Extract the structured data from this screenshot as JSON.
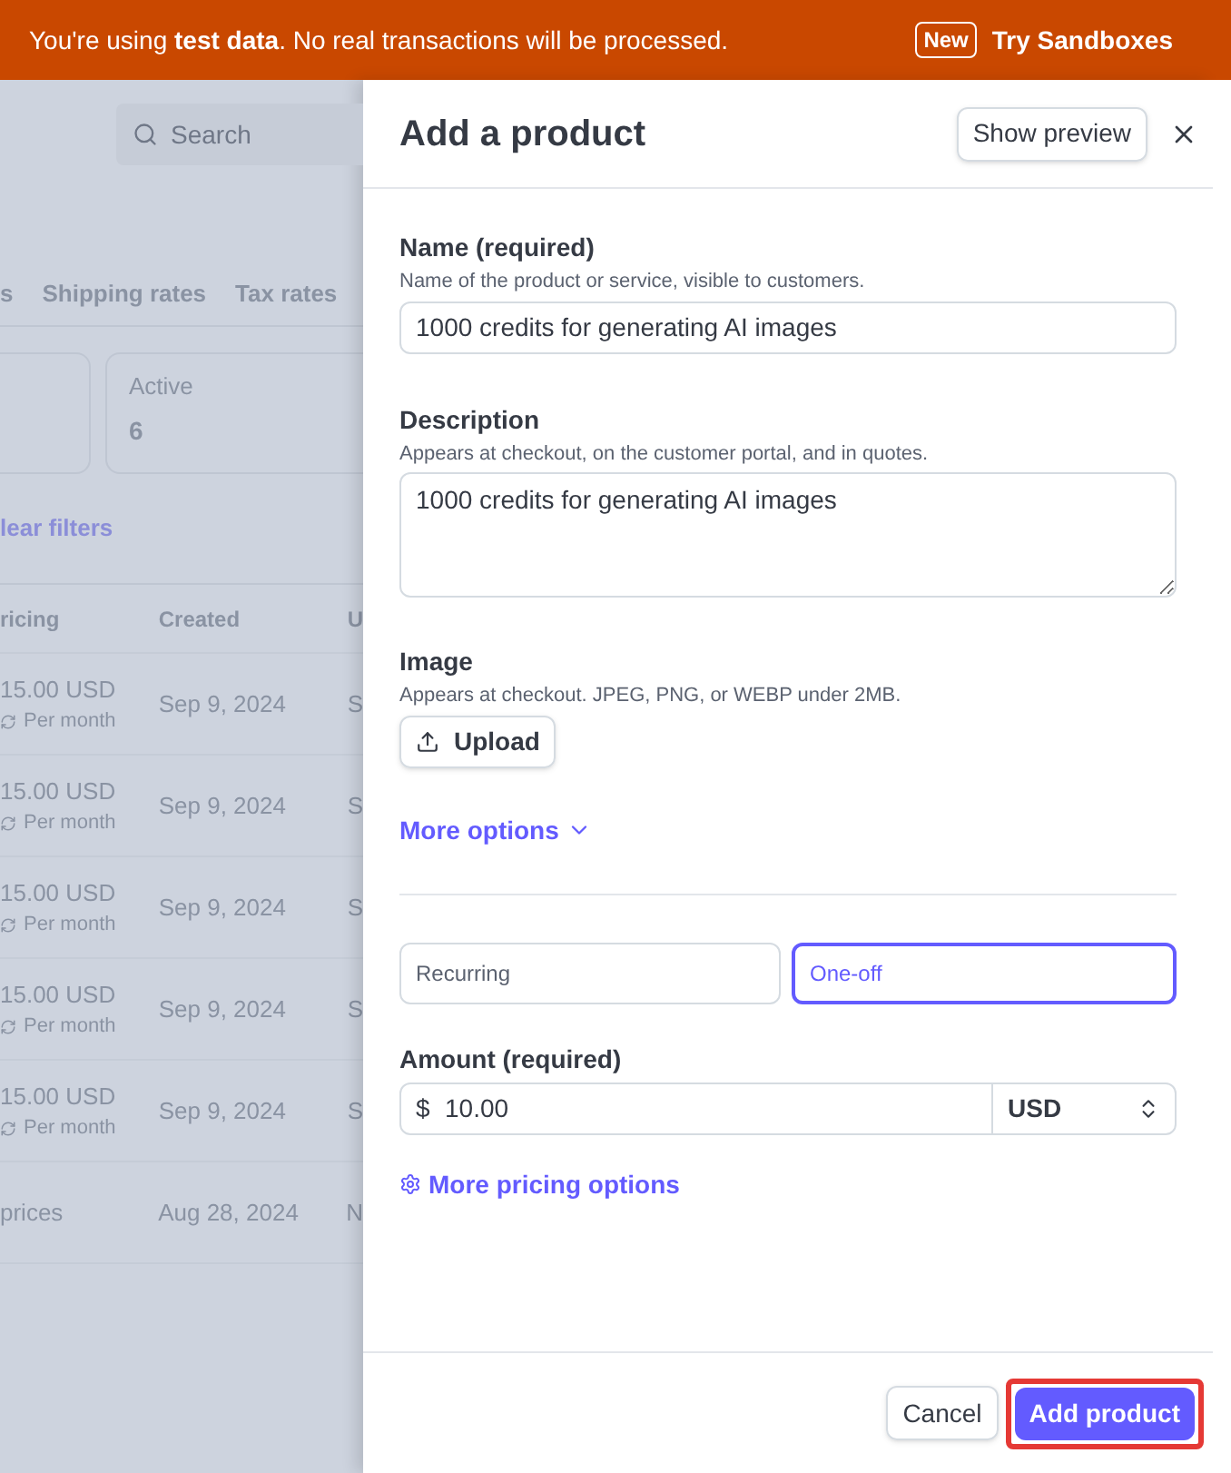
{
  "banner": {
    "message": "You're using **test data**. No real transactions will be processed.",
    "badge": "New",
    "link": "Try Sandboxes"
  },
  "background": {
    "search": {
      "placeholder": "Search"
    },
    "tabs": [
      "s",
      "Shipping rates",
      "Tax rates"
    ],
    "cards": [
      {
        "label": "Active",
        "value": "6"
      }
    ],
    "clear_filters": "lear filters",
    "table": {
      "columns": [
        "ricing",
        "Created",
        "U"
      ],
      "rows": [
        {
          "price": "15.00 USD",
          "interval": "Per month",
          "created": "Sep 9, 2024",
          "column_3": "S"
        },
        {
          "price": "15.00 USD",
          "interval": "Per month",
          "created": "Sep 9, 2024",
          "column_3": "S"
        },
        {
          "price": "15.00 USD",
          "interval": "Per month",
          "created": "Sep 9, 2024",
          "column_3": "S"
        },
        {
          "price": "15.00 USD",
          "interval": "Per month",
          "created": "Sep 9, 2024",
          "column_3": "S"
        },
        {
          "price": "15.00 USD",
          "interval": "Per month",
          "created": "Sep 9, 2024",
          "column_3": "S"
        },
        {
          "price": "prices",
          "created": "Aug 28, 2024",
          "column_3": "N"
        }
      ]
    }
  },
  "panel": {
    "title": "Add a product",
    "preview_button": "Show preview",
    "name": {
      "label": "Name (required)",
      "hint": "Name of the product or service, visible to customers.",
      "value": "1000 credits for generating AI images"
    },
    "description": {
      "label": "Description",
      "hint": "Appears at checkout, on the customer portal, and in quotes.",
      "value": "1000 credits for generating AI images"
    },
    "image": {
      "label": "Image",
      "hint": "Appears at checkout. JPEG, PNG, or WEBP under 2MB.",
      "button": "Upload"
    },
    "more_options": "More options",
    "pricing_types": [
      {
        "label": "Recurring",
        "selected": false
      },
      {
        "label": "One-off",
        "selected": true
      }
    ],
    "amount": {
      "label": "Amount (required)",
      "symbol": "$",
      "value": "10.00",
      "currency": "USD"
    },
    "more_pricing": "More pricing options",
    "footer": {
      "cancel": "Cancel",
      "submit": "Add product"
    }
  }
}
